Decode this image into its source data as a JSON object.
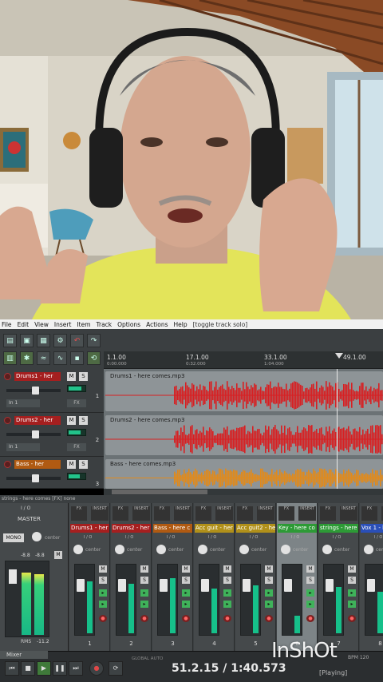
{
  "menu": {
    "items": [
      "File",
      "Edit",
      "View",
      "Insert",
      "Item",
      "Track",
      "Options",
      "Actions",
      "Help"
    ],
    "status": "[toggle track solo]"
  },
  "ruler": {
    "markers": [
      {
        "label": "1.1.00",
        "sub": "0:00.000"
      },
      {
        "label": "17.1.00",
        "sub": "0:32.000"
      },
      {
        "label": "33.1.00",
        "sub": "1:04.000"
      },
      {
        "label": "49.1.00",
        "sub": ""
      }
    ]
  },
  "tracks": [
    {
      "name": "Drums1 - her",
      "color": "#a51f1f",
      "input": "In 1",
      "number": "1",
      "item_label": "Drums1 - here comes.mp3",
      "wave_color": "#d81f22",
      "volume": 0.55,
      "meter": 0.8
    },
    {
      "name": "Drums2 - her",
      "color": "#a51f1f",
      "input": "In 1",
      "number": "2",
      "item_label": "Drums2 - here comes.mp3",
      "wave_color": "#d81f22",
      "volume": 0.55,
      "meter": 0.75
    },
    {
      "name": "Bass - her",
      "color": "#b05a12",
      "input": "In 1",
      "number": "3",
      "item_label": "Bass - here comes.mp3",
      "wave_color": "#e28a1a",
      "volume": 0.55,
      "meter": 0.7
    }
  ],
  "track_buttons": {
    "mute": "M",
    "solo": "S",
    "fx": "FX"
  },
  "mixer": {
    "header": "strings - here comes [FX] none",
    "master_label": "MASTER",
    "master_io": "I / O",
    "master_mono": "MONO",
    "master_center": "center",
    "master_db": [
      "-8.8",
      "-8.8"
    ],
    "master_rms": "RMS",
    "master_rms_value": "-11.2",
    "strips": [
      {
        "name": "Drums1 - her",
        "color": "#a51f1f",
        "number": "1",
        "pan": "center",
        "meter": 0.75,
        "fader": 0.25
      },
      {
        "name": "Drums2 - her",
        "color": "#a51f1f",
        "number": "2",
        "pan": "center",
        "meter": 0.72,
        "fader": 0.25
      },
      {
        "name": "Bass - here c",
        "color": "#b05a12",
        "number": "3",
        "pan": "center",
        "meter": 0.8,
        "fader": 0.25
      },
      {
        "name": "Acc guit - her",
        "color": "#b0901a",
        "number": "4",
        "pan": "center",
        "meter": 0.65,
        "fader": 0.25
      },
      {
        "name": "Acc guit2 - her",
        "color": "#b0901a",
        "number": "5",
        "pan": "center",
        "meter": 0.7,
        "fader": 0.25
      },
      {
        "name": "Key - here co",
        "color": "#2d9a36",
        "number": "6",
        "pan": "center",
        "meter": 0.25,
        "fader": 0.25
      },
      {
        "name": "strings - here",
        "color": "#2d9a36",
        "number": "7",
        "pan": "center",
        "meter": 0.68,
        "fader": 0.25
      },
      {
        "name": "Vox 1 - her",
        "color": "#2a4fb8",
        "number": "8",
        "pan": "center",
        "meter": 0.6,
        "fader": 0.25
      }
    ],
    "strip_fx_labels": [
      "FX",
      "INSERT"
    ],
    "io_label": "I / O"
  },
  "transport": {
    "mixer_tab": "Mixer",
    "position": "51.2.15 / 1:40.573",
    "state": "[Playing]",
    "bpm_label": "BPM",
    "bpm": "120",
    "global_auto": "GLOBAL AUTO"
  },
  "watermark": "InShOt"
}
